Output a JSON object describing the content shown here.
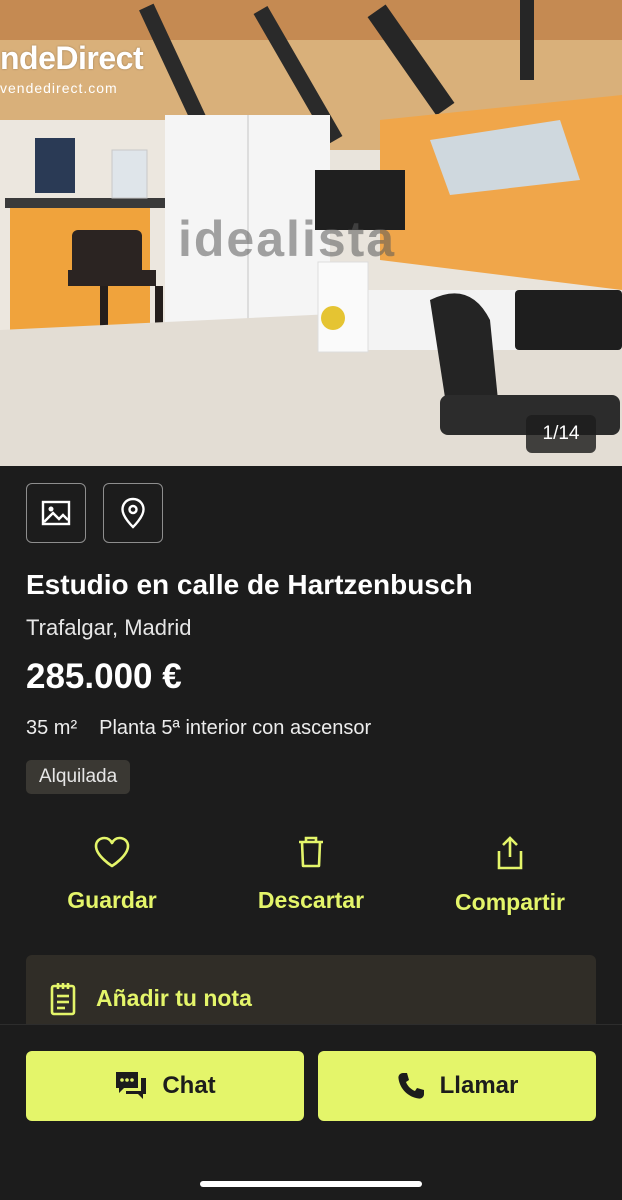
{
  "photo": {
    "brand": "ndeDirect",
    "brand_url": "vendedirect.com",
    "watermark": "idealista",
    "counter": "1/14"
  },
  "media_buttons": [
    {
      "icon": "image-icon"
    },
    {
      "icon": "map-pin-icon"
    }
  ],
  "listing": {
    "title": "Estudio en calle de Hartzenbusch",
    "location": "Trafalgar, Madrid",
    "price": "285.000 €",
    "size": "35 m²",
    "floor": "Planta 5ª interior con ascensor",
    "status_badge": "Alquilada"
  },
  "actions": {
    "save": "Guardar",
    "discard": "Descartar",
    "share": "Compartir"
  },
  "note": {
    "label": "Añadir tu nota"
  },
  "cta": {
    "chat": "Chat",
    "call": "Llamar"
  },
  "colors": {
    "background": "#1c1c1c",
    "accent": "#e4f56a",
    "note_bg": "#302d27",
    "badge_bg": "#3a3833"
  }
}
